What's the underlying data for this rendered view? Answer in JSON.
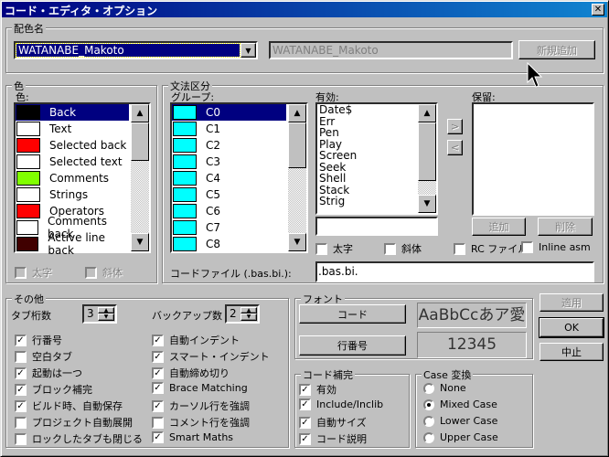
{
  "title": "コード・エディタ・オプション",
  "scheme": {
    "label": "配色名",
    "selected": "WATANABE_Makoto",
    "name_field": "WATANABE_Makoto",
    "add_button": "新規追加"
  },
  "color": {
    "group": "色",
    "label": "色:",
    "items": [
      {
        "label": "Back",
        "color": "#000000"
      },
      {
        "label": "Text",
        "color": "#ffffff"
      },
      {
        "label": "Selected back",
        "color": "#ff0000"
      },
      {
        "label": "Selected text",
        "color": "#ffffff"
      },
      {
        "label": "Comments",
        "color": "#80ff00"
      },
      {
        "label": "Strings",
        "color": "#ffffff"
      },
      {
        "label": "Operators",
        "color": "#ff0000"
      },
      {
        "label": "Comments back",
        "color": "#ffffff"
      },
      {
        "label": "Active line back",
        "color": "#400000"
      }
    ],
    "bold": "太字",
    "italic": "斜体"
  },
  "syntax": {
    "group": "文法区分",
    "group_label": "グループ:",
    "groups": [
      "C0",
      "C1",
      "C2",
      "C3",
      "C4",
      "C5",
      "C6",
      "C7",
      "C8"
    ],
    "group_color": "#00ffff",
    "enabled_label": "有効:",
    "enabled": [
      "Date$",
      "Err",
      "Pen",
      "Play",
      "Screen",
      "Seek",
      "Shell",
      "Stack",
      "Strig"
    ],
    "reserved_label": "保留:",
    "move_right": ">",
    "move_left": "<",
    "add": "追加",
    "delete": "削除",
    "bold": "太字",
    "italic": "斜体",
    "rc_file": "RC ファイル",
    "inline_asm": "Inline asm",
    "code_file_label": "コードファイル (.bas.bi.):",
    "code_file_value": ".bas.bi."
  },
  "other": {
    "group": "その他",
    "tab_label": "タブ桁数",
    "tab_value": "3",
    "backup_label": "バックアップ数",
    "backup_value": "2",
    "left": [
      {
        "label": "行番号",
        "checked": true
      },
      {
        "label": "空白タブ",
        "checked": false
      },
      {
        "label": "起動は一つ",
        "checked": true
      },
      {
        "label": "ブロック補完",
        "checked": true
      },
      {
        "label": "ビルド時、自動保存",
        "checked": true
      },
      {
        "label": "プロジェクト自動展開",
        "checked": false
      },
      {
        "label": "ロックしたタブも閉じる",
        "checked": false
      }
    ],
    "right": [
      {
        "label": "自動インデント",
        "checked": true
      },
      {
        "label": "スマート・インデント",
        "checked": true
      },
      {
        "label": "自動締め切り",
        "checked": true
      },
      {
        "label": "Brace Matching",
        "checked": true
      },
      {
        "label": "カーソル行を強調",
        "checked": true
      },
      {
        "label": "コメント行を強調",
        "checked": false
      },
      {
        "label": "Smart Maths",
        "checked": true
      }
    ]
  },
  "font": {
    "group": "フォント",
    "code_button": "コード",
    "line_button": "行番号",
    "code_sample": "AaBbCcあア愛",
    "line_sample": "12345"
  },
  "completion": {
    "group": "コード補完",
    "items": [
      {
        "label": "有効",
        "checked": true
      },
      {
        "label": "Include/Inclib",
        "checked": true
      },
      {
        "label": "自動サイズ",
        "checked": true
      },
      {
        "label": "コード説明",
        "checked": true
      }
    ]
  },
  "case": {
    "group": "Case 変換",
    "options": [
      "None",
      "Mixed Case",
      "Lower Case",
      "Upper Case"
    ],
    "selected": "Mixed Case"
  },
  "buttons": {
    "apply": "適用",
    "ok": "OK",
    "cancel": "中止"
  }
}
